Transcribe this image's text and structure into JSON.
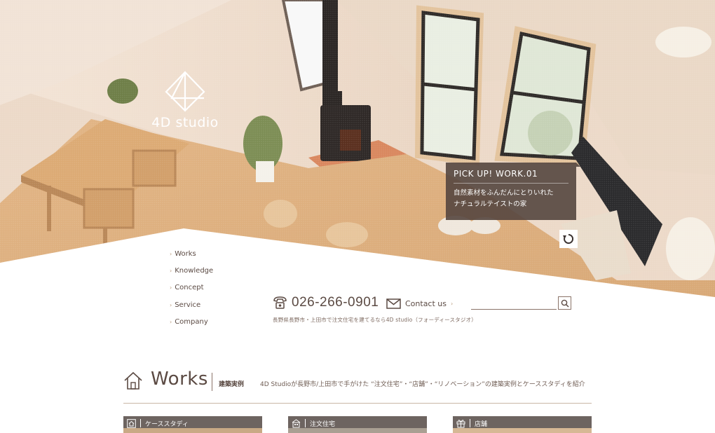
{
  "brand": {
    "name": "4D studio"
  },
  "colors": {
    "primary": "#5b4a43",
    "accent": "#b89a7a",
    "pickup_bg": "#55463f",
    "category_bg": "#6d6460"
  },
  "pickup": {
    "title": "PICK UP!  WORK.01",
    "line1": "自然素材をふんだんにとりいれた",
    "line2": "ナチュラルテイストの家"
  },
  "nav": {
    "items": [
      {
        "label": "Works"
      },
      {
        "label": "Knowledge"
      },
      {
        "label": "Concept"
      },
      {
        "label": "Service"
      },
      {
        "label": "Company"
      }
    ]
  },
  "contact": {
    "phone": "026-266-0901",
    "contact_label": "Contact us",
    "search_placeholder": "",
    "tagline": "長野県長野市・上田市で注文住宅を建てるなら4D studio（フォーディースタジオ）"
  },
  "works": {
    "title": "Works",
    "subtitle": "建築実例",
    "description": "4D Studioが長野市/上田市で手がけた “注文住宅”・“店舗”・“リノベーション”の建築実例とケーススタディを紹介",
    "categories": [
      {
        "label": "ケーススタディ",
        "icon": "house-outline-icon"
      },
      {
        "label": "注文住宅",
        "icon": "building-icon"
      },
      {
        "label": "店舗",
        "icon": "gift-icon"
      }
    ]
  }
}
